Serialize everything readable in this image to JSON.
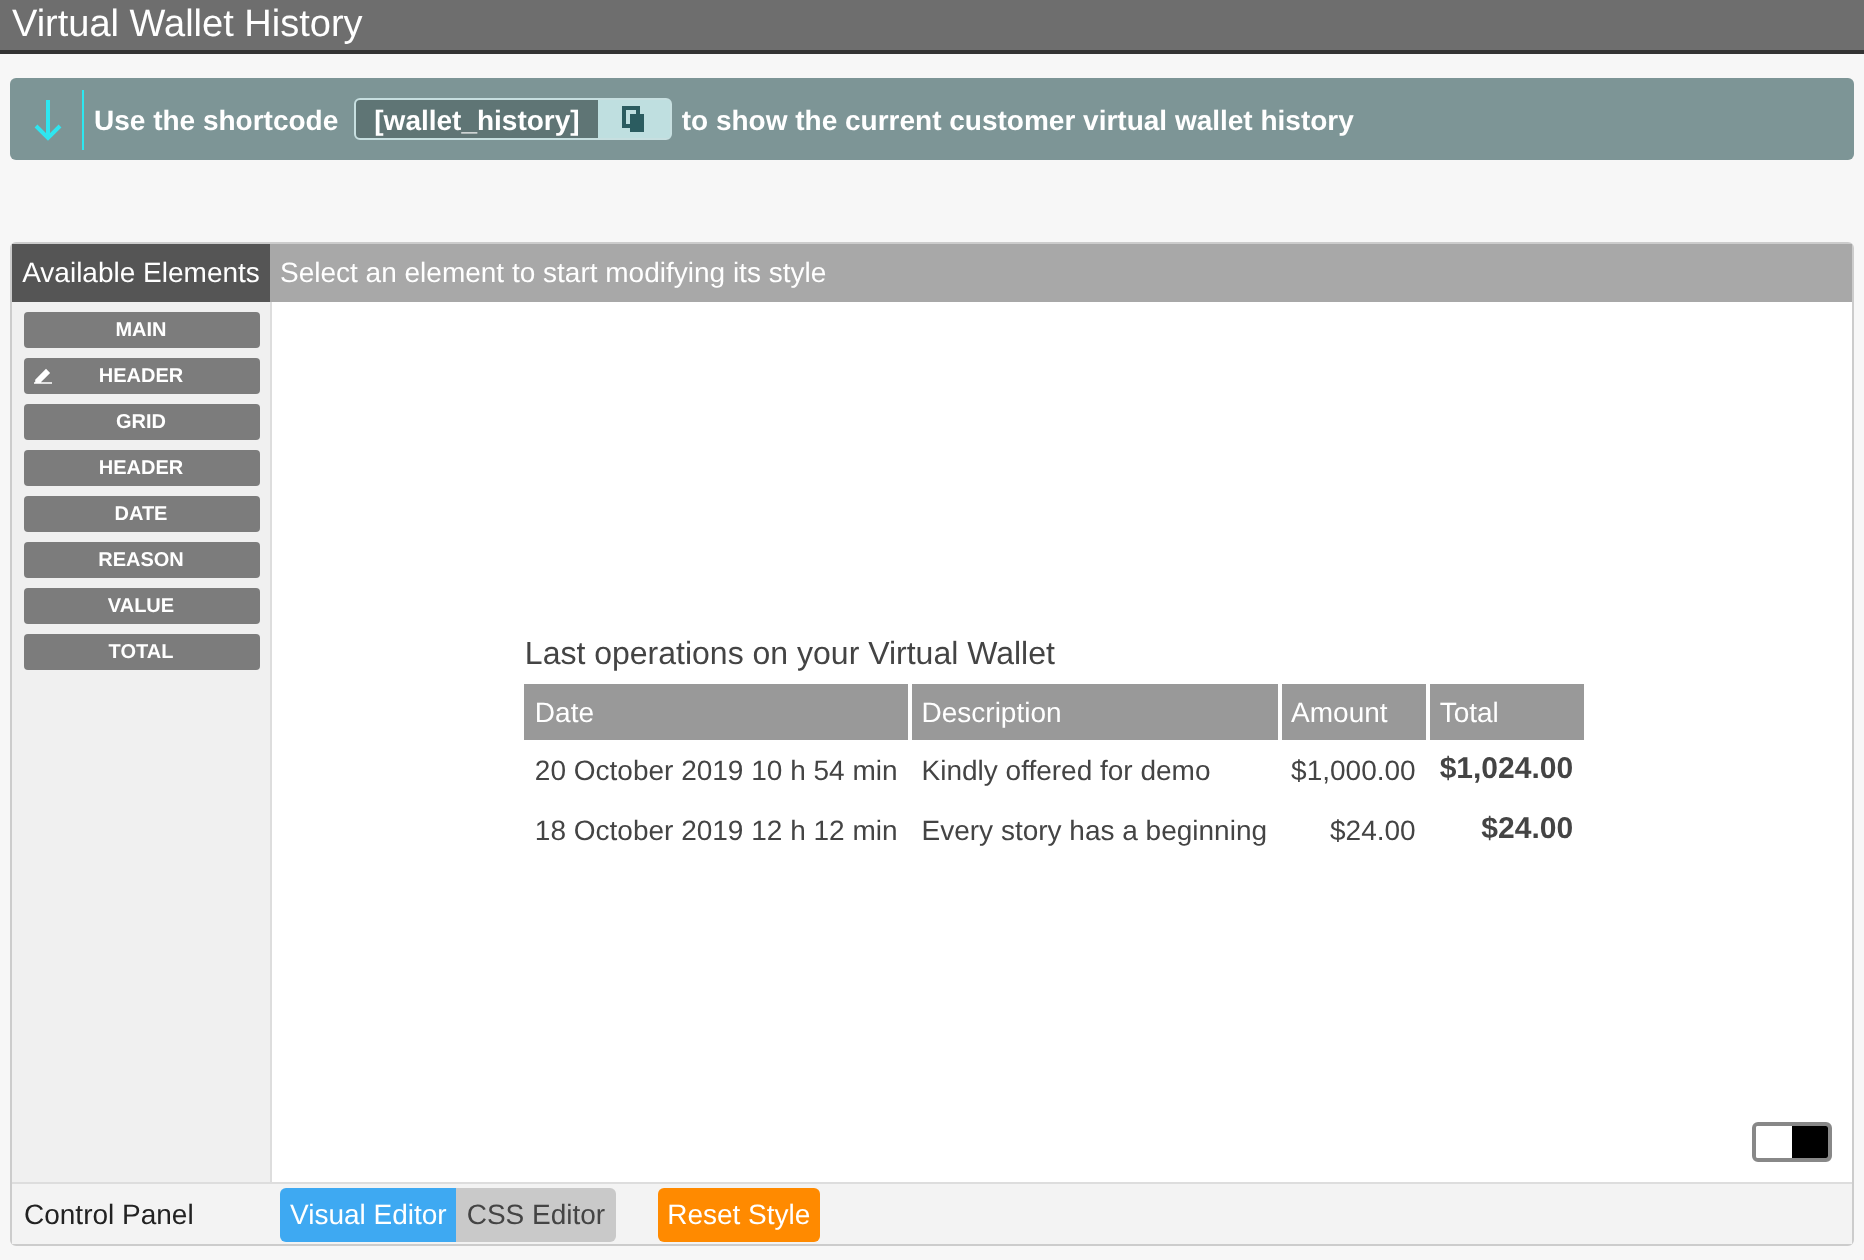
{
  "window": {
    "title": "Virtual Wallet History"
  },
  "notice": {
    "before": "Use the shortcode",
    "shortcode": "[wallet_history]",
    "after": "to show the current customer virtual wallet history"
  },
  "sidebar": {
    "title": "Available Elements",
    "items": [
      {
        "label": "MAIN",
        "editing": false
      },
      {
        "label": "HEADER",
        "editing": true
      },
      {
        "label": "GRID",
        "editing": false
      },
      {
        "label": "HEADER",
        "editing": false
      },
      {
        "label": "DATE",
        "editing": false
      },
      {
        "label": "REASON",
        "editing": false
      },
      {
        "label": "VALUE",
        "editing": false
      },
      {
        "label": "TOTAL",
        "editing": false
      }
    ]
  },
  "hint": "Select an element to start modifying its style",
  "preview": {
    "title": "Last operations on your Virtual Wallet",
    "columns": [
      "Date",
      "Description",
      "Amount",
      "Total"
    ],
    "rows": [
      [
        "20 October 2019 10 h 54 min",
        "Kindly offered for demo",
        "$1,000.00",
        "$1,024.00"
      ],
      [
        "18 October 2019 12 h 12 min",
        "Every story has a beginning",
        "$24.00",
        "$24.00"
      ]
    ]
  },
  "background_toggle": {
    "on": true
  },
  "footer": {
    "label": "Control Panel",
    "tabs": [
      {
        "label": "Visual Editor",
        "selected": true
      },
      {
        "label": "CSS Editor",
        "selected": false
      }
    ],
    "reset": "Reset Style"
  }
}
